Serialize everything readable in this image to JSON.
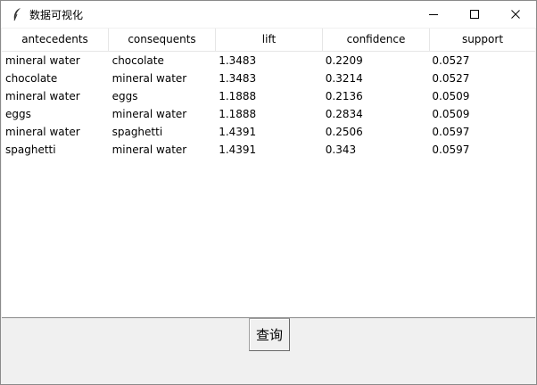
{
  "window": {
    "title": "数据可视化",
    "icons": {
      "app": "feather-icon",
      "minimize": "minimize-icon",
      "maximize": "maximize-icon",
      "close": "close-icon"
    }
  },
  "table": {
    "columns": [
      "antecedents",
      "consequents",
      "lift",
      "confidence",
      "support"
    ],
    "rows": [
      [
        "mineral water",
        "chocolate",
        "1.3483",
        "0.2209",
        "0.0527"
      ],
      [
        "chocolate",
        "mineral water",
        "1.3483",
        "0.3214",
        "0.0527"
      ],
      [
        "mineral water",
        "eggs",
        "1.1888",
        "0.2136",
        "0.0509"
      ],
      [
        "eggs",
        "mineral water",
        "1.1888",
        "0.2834",
        "0.0509"
      ],
      [
        "mineral water",
        "spaghetti",
        "1.4391",
        "0.2506",
        "0.0597"
      ],
      [
        "spaghetti",
        "mineral water",
        "1.4391",
        "0.343",
        "0.0597"
      ]
    ]
  },
  "query_button": {
    "label": "查询"
  }
}
